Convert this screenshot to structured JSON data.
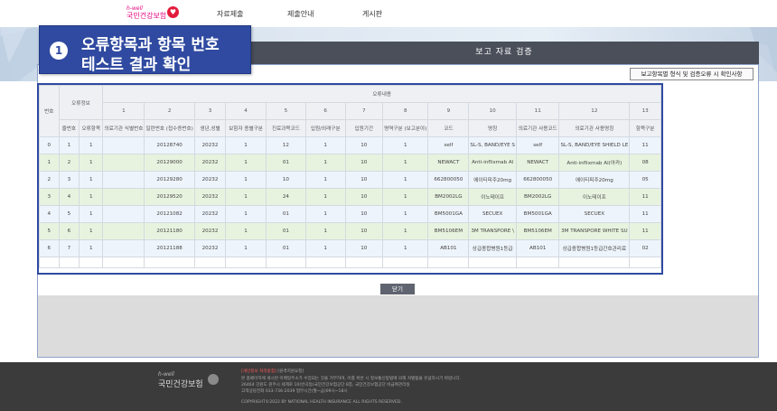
{
  "header": {
    "logo_sub": "h-well",
    "logo_name": "국민건강보험",
    "nav": [
      "자료제출",
      "제출안내",
      "게시판"
    ]
  },
  "callout": {
    "number": "1",
    "line1": "오류항목과 항목 번호",
    "line2": "테스트 결과 확인"
  },
  "dialog": {
    "title": "보고 자료 검증",
    "check_button": "보고항목별 형식 및 검증오류 시 확인사항",
    "close_button": "닫기"
  },
  "table": {
    "header_no": "번호",
    "header_error_info": "오류정보",
    "header_error_content": "오류내용",
    "sub_headers": [
      "줄번호",
      "오류항목"
    ],
    "columns": [
      {
        "num": "1",
        "name": "의료기관 식별번호"
      },
      {
        "num": "2",
        "name": "일련번호 (접수증번호)"
      },
      {
        "num": "3",
        "name": "생년,성별"
      },
      {
        "num": "4",
        "name": "보험자 종별구분"
      },
      {
        "num": "5",
        "name": "진료과목코드"
      },
      {
        "num": "6",
        "name": "입원/외래구분"
      },
      {
        "num": "7",
        "name": "입원기간"
      },
      {
        "num": "8",
        "name": "명역구분 (보고분야)"
      },
      {
        "num": "9",
        "name": "코드"
      },
      {
        "num": "10",
        "name": "명칭"
      },
      {
        "num": "11",
        "name": "의료기관 사용코드"
      },
      {
        "num": "12",
        "name": "의료기관 사용명칭"
      },
      {
        "num": "13",
        "name": "항목구분"
      }
    ],
    "rows": [
      [
        "0",
        "1",
        "1",
        "",
        "20128740",
        "20232",
        "1",
        "12",
        "1",
        "10",
        "1",
        "self",
        "SL-S, BAND/EYE S",
        "self",
        "SL-S, BAND/EYE SHIELD LE",
        "11"
      ],
      [
        "1",
        "2",
        "1",
        "",
        "20129000",
        "20232",
        "1",
        "01",
        "1",
        "10",
        "1",
        "NEWACT",
        "Anti-inflixmab Al",
        "NEWACT",
        "Anti-inflixmab Al(아카)",
        "08"
      ],
      [
        "2",
        "3",
        "1",
        "",
        "20129280",
        "20232",
        "1",
        "10",
        "1",
        "10",
        "1",
        "662800050",
        "에이티피주20mg",
        "662800050",
        "에이티피주20mg",
        "05"
      ],
      [
        "3",
        "4",
        "1",
        "",
        "20129520",
        "20232",
        "1",
        "24",
        "1",
        "10",
        "1",
        "BM2002LG",
        "이노테이프",
        "BM2002LG",
        "이노테이프",
        "11"
      ],
      [
        "4",
        "5",
        "1",
        "",
        "20121082",
        "20232",
        "1",
        "01",
        "1",
        "10",
        "1",
        "BM5001GA",
        "SECUEX",
        "BM5001GA",
        "SECUEX",
        "11"
      ],
      [
        "5",
        "6",
        "1",
        "",
        "20121180",
        "20232",
        "1",
        "01",
        "1",
        "10",
        "1",
        "BM5106EM",
        "3M TRANSPORE \\",
        "BM5106EM",
        "3M TRANSPORE WHITE SU",
        "11"
      ],
      [
        "6",
        "7",
        "1",
        "",
        "20121188",
        "20232",
        "1",
        "01",
        "1",
        "10",
        "1",
        "AB101",
        "상급종합병원1등급",
        "AB101",
        "상급종합병원1등급간호관리료",
        "02"
      ]
    ]
  },
  "footer": {
    "logo_sub": "h-well",
    "logo_name": "국민건강보험",
    "line1_red": "[개인정보 처리방침]",
    "line1_rest": "[원격지원요청]",
    "line2": "본 홈페이지에 게시된 이메일주소가 수집되는 것을 거부하며, 이를 위반 시 정보통신망법에 의해 처벌됨을 유념하시기 바랍니다.",
    "line3": "26464 강원도 원주시 세계로 10(반곡동)국민건강보험공단 8층, 국민건강보험공단 비급여관리실",
    "line4": "고객상담전화 033-736-2039 업무시간(월~금)09시~18시",
    "copyright": "COPYRIGHT©2022 BY NATIONAL HEALTH INSURANCE ALL RIGHTS RESERVED."
  }
}
